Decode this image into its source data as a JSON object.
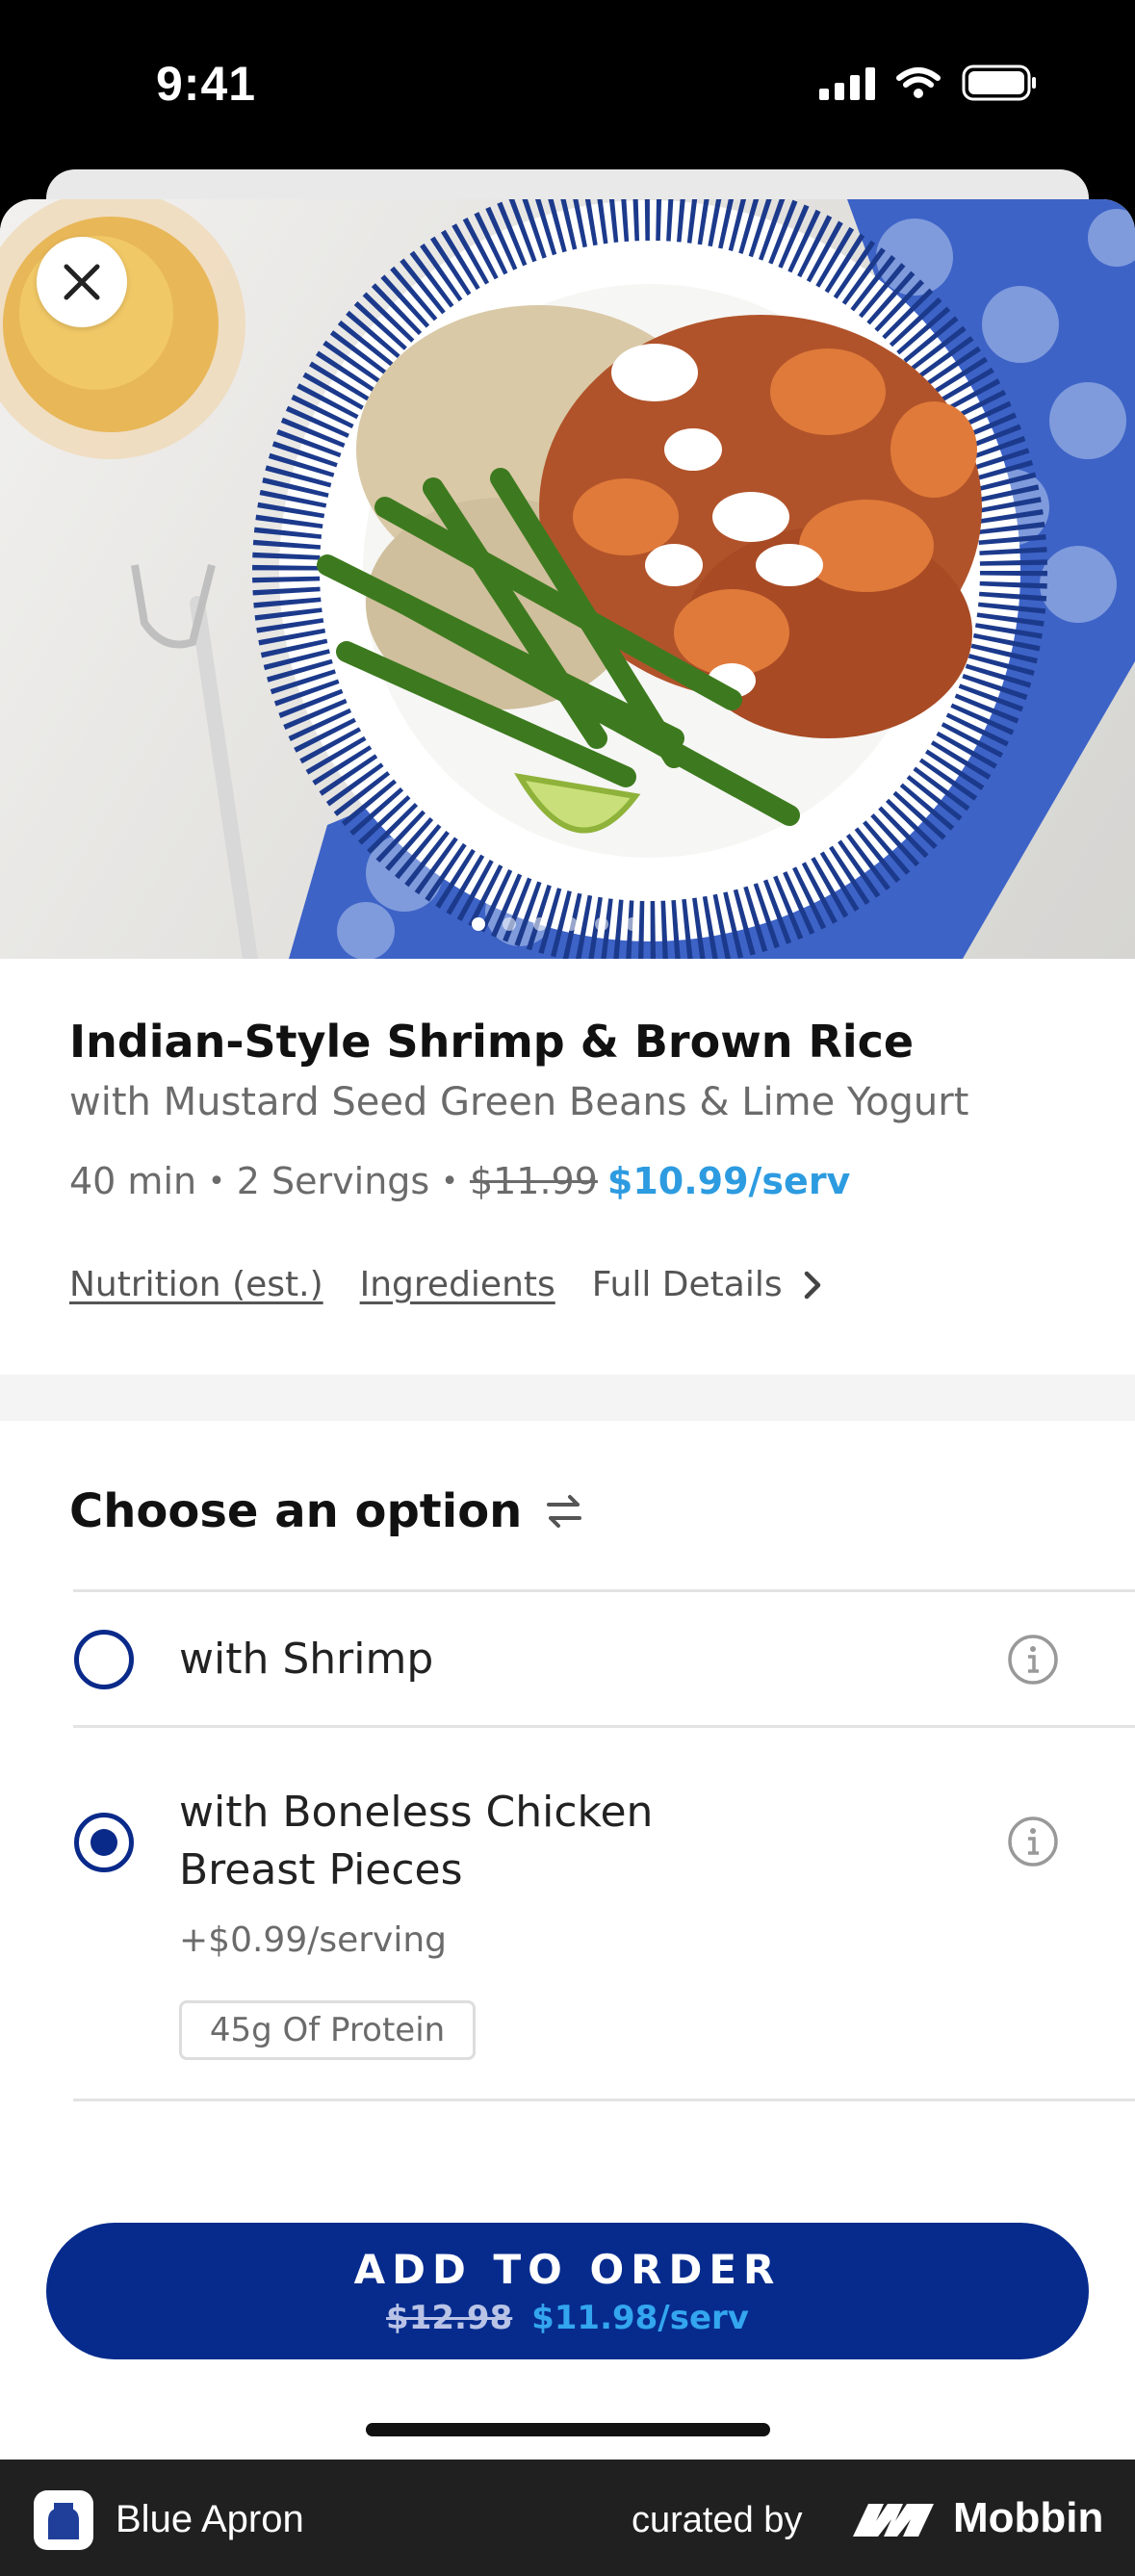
{
  "status_bar": {
    "time": "9:41"
  },
  "recipe": {
    "title": "Indian-Style Shrimp & Brown Rice",
    "subtitle": "with Mustard Seed Green Beans & Lime Yogurt",
    "time": "40 min",
    "servings": "2 Servings",
    "original_price": "$11.99",
    "price": "$10.99/serv",
    "image_dots": 6,
    "active_dot": 1
  },
  "links": {
    "nutrition": "Nutrition (est.)",
    "ingredients": "Ingredients",
    "full_details": "Full Details"
  },
  "options": {
    "heading": "Choose an option",
    "items": [
      {
        "label": "with Shrimp",
        "selected": false
      },
      {
        "label_line1": "with Boneless Chicken",
        "label_line2": "Breast Pieces",
        "price": "+$0.99/serving",
        "badge": "45g Of Protein",
        "selected": true
      }
    ]
  },
  "cta": {
    "label": "ADD TO ORDER",
    "original_price": "$12.98",
    "price": "$11.98/serv"
  },
  "footer": {
    "app_name": "Blue Apron",
    "curated_by": "curated by",
    "brand": "Mobbin"
  },
  "colors": {
    "primary_navy": "#062b8d",
    "price_blue": "#2d9be0",
    "radio_navy": "#0a2a8a"
  }
}
